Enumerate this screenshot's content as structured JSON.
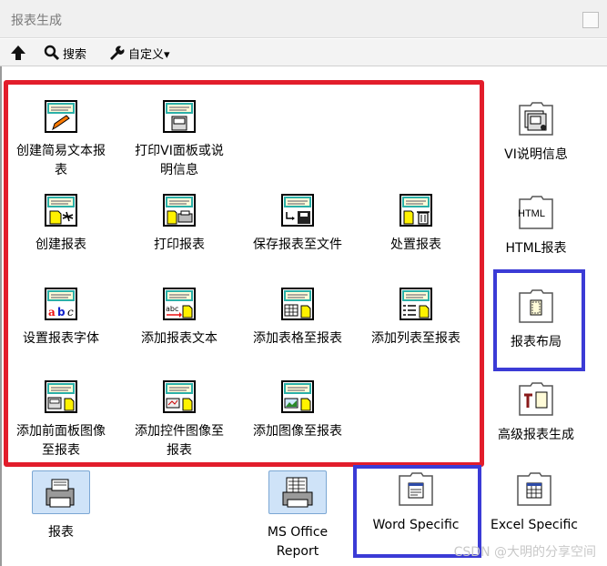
{
  "window": {
    "title": "报表生成"
  },
  "toolbar": {
    "search_label": "搜索",
    "customize_label": "自定义▾"
  },
  "grid": [
    {
      "label": "创建简易文本报\n表",
      "icon": "report-pencil-icon"
    },
    {
      "label": "打印VI面板或说\n明信息",
      "icon": "print-vi-panel-icon"
    },
    {
      "label": "创建报表",
      "icon": "create-report-icon"
    },
    {
      "label": "打印报表",
      "icon": "print-report-icon"
    },
    {
      "label": "保存报表至文件",
      "icon": "save-report-icon"
    },
    {
      "label": "处置报表",
      "icon": "dispose-report-icon"
    },
    {
      "label": "设置报表字体",
      "icon": "report-font-icon"
    },
    {
      "label": "添加报表文本",
      "icon": "append-text-icon"
    },
    {
      "label": "添加表格至报表",
      "icon": "append-table-icon"
    },
    {
      "label": "添加列表至报表",
      "icon": "append-list-icon"
    },
    {
      "label": "添加前面板图像\n至报表",
      "icon": "append-front-panel-image-icon"
    },
    {
      "label": "添加控件图像至\n报表",
      "icon": "append-control-image-icon"
    },
    {
      "label": "添加图像至报表",
      "icon": "append-image-icon"
    }
  ],
  "side": [
    {
      "label": "VI说明信息",
      "icon": "vi-documentation-folder-icon"
    },
    {
      "label": "HTML报表",
      "icon": "html-folder-icon",
      "folder_text": "HTML"
    },
    {
      "label": "报表布局",
      "icon": "report-layout-folder-icon"
    },
    {
      "label": "高级报表生成",
      "icon": "advanced-report-folder-icon"
    }
  ],
  "bottom": [
    {
      "label": "报表",
      "icon": "report-printer-icon"
    },
    {
      "label": "MS Office\nReport",
      "icon": "ms-office-report-icon"
    },
    {
      "label": "Word Specific",
      "icon": "word-specific-folder-icon"
    },
    {
      "label": "Excel Specific",
      "icon": "excel-specific-folder-icon"
    }
  ],
  "watermark": "CSDN @大明的分享空间"
}
